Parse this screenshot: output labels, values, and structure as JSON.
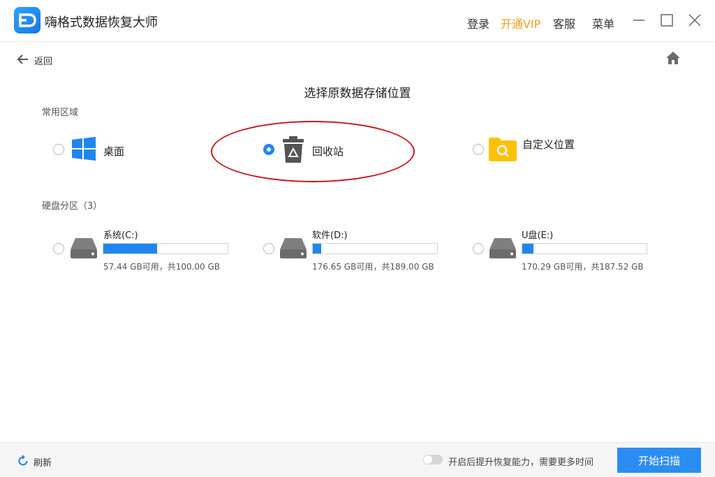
{
  "app": {
    "title": "嗨格式数据恢复大师"
  },
  "top_menu": {
    "login": "登录",
    "vip": "开通VIP",
    "service": "客服",
    "menu": "菜单"
  },
  "nav": {
    "back": "返回"
  },
  "page": {
    "title": "选择原数据存储位置"
  },
  "common": {
    "label": "常用区域",
    "options": [
      {
        "label": "桌面",
        "selected": false
      },
      {
        "label": "回收站",
        "selected": true
      },
      {
        "label": "自定义位置",
        "selected": false
      }
    ]
  },
  "disks": {
    "label": "硬盘分区（3）",
    "items": [
      {
        "name": "系统(C:)",
        "info": "57.44 GB可用，共100.00 GB",
        "used_fraction": 0.43
      },
      {
        "name": "软件(D:)",
        "info": "176.65 GB可用，共189.00 GB",
        "used_fraction": 0.065
      },
      {
        "name": "U盘(E:)",
        "info": "170.29 GB可用，共187.52 GB",
        "used_fraction": 0.092
      }
    ]
  },
  "footer": {
    "refresh": "刷新",
    "toggle_label": "开启后提升恢复能力，需要更多时间",
    "toggle_on": false,
    "start": "开始扫描"
  },
  "colors": {
    "accent": "#1f86f0",
    "vip": "#f39a1e",
    "annotation": "#c4161c",
    "folder": "#ffc107"
  }
}
